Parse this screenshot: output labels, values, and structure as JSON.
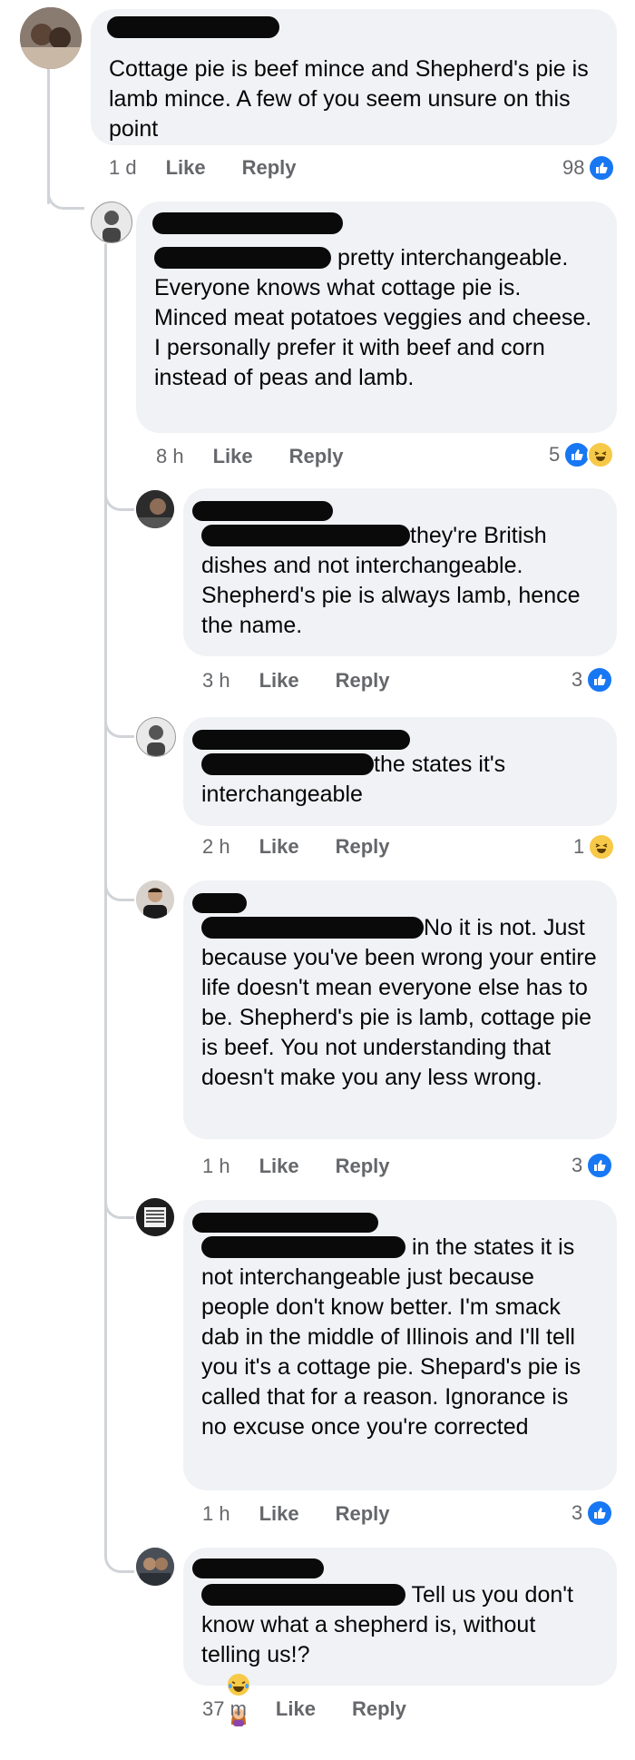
{
  "comments": [
    {
      "text": "Cottage pie is beef mince and Shepherd's pie is lamb mince. A few of you seem unsure on this point",
      "time": "1 d",
      "like": "Like",
      "reply": "Reply",
      "reaction_count": "98",
      "reactions": [
        "like-icon"
      ]
    },
    {
      "text": " pretty interchangeable. Everyone knows what cottage pie is. Minced meat potatoes veggies and cheese. I personally prefer it with beef and corn instead of peas and lamb.",
      "time": "8 h",
      "like": "Like",
      "reply": "Reply",
      "reaction_count": "5",
      "reactions": [
        "like-icon",
        "haha-icon"
      ]
    },
    {
      "text": "they're British dishes and not interchangeable. Shepherd's pie is always lamb, hence the name.",
      "time": "3 h",
      "like": "Like",
      "reply": "Reply",
      "reaction_count": "3",
      "reactions": [
        "like-icon"
      ]
    },
    {
      "text": "the states it's interchangeable",
      "time": "2 h",
      "like": "Like",
      "reply": "Reply",
      "reaction_count": "1",
      "reactions": [
        "haha-icon"
      ]
    },
    {
      "text": "No it is not. Just because you've been wrong your entire life doesn't mean everyone else has to be. Shepherd's pie is lamb, cottage pie is beef. You not understanding that doesn't make you any less wrong.",
      "time": "1 h",
      "like": "Like",
      "reply": "Reply",
      "reaction_count": "3",
      "reactions": [
        "like-icon"
      ]
    },
    {
      "text": " in the states it is not interchangeable just because people don't know better. I'm smack dab in the middle of Illinois and I'll tell you it's a cottage pie. Shepard's pie is called that for a reason. Ignorance is no excuse once you're corrected",
      "time": "1 h",
      "like": "Like",
      "reply": "Reply",
      "reaction_count": "3",
      "reactions": [
        "like-icon"
      ]
    },
    {
      "text": " Tell us you don't know what a shepherd is, without telling us!?",
      "emoji": [
        "tears-of-joy-emoji",
        "woman-facepalming-emoji"
      ],
      "time": "37 m",
      "like": "Like",
      "reply": "Reply"
    }
  ],
  "colors": {
    "bubble": "#f0f2f5",
    "meta_text": "#65676b",
    "like_blue": "#1877f2",
    "haha_yellow": "#f7c948",
    "thread_line": "#d0d3d8"
  }
}
